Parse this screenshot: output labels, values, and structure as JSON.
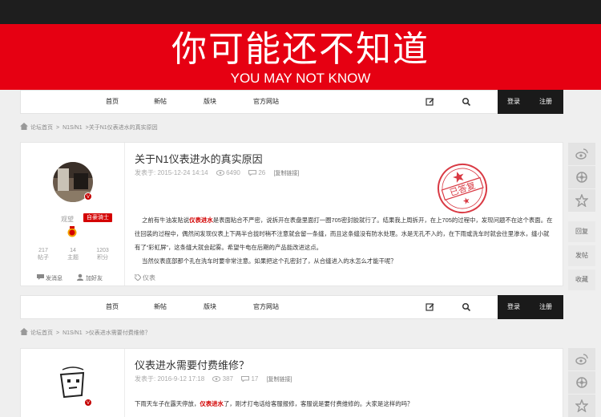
{
  "banner": {
    "title_cn": "你可能还不知道",
    "title_en": "YOU MAY NOT KNOW"
  },
  "nav": {
    "items": [
      "首页",
      "新帖",
      "版块",
      "官方网站"
    ],
    "login": "登录",
    "register": "注册"
  },
  "post1": {
    "breadcrumb": [
      "论坛首页",
      ">",
      "N1S/N1",
      ">关于N1仪表进水的真实原因"
    ],
    "author": {
      "name": "观望",
      "level": "自豪骑士",
      "stats": [
        {
          "value": "217",
          "label": "帖子"
        },
        {
          "value": "14",
          "label": "主题"
        },
        {
          "value": "1203",
          "label": "积分"
        }
      ],
      "send_message": "发消息",
      "add_friend": "加好友"
    },
    "title": "关于N1仪表进水的真实原因",
    "date": "发表于: 2015-12-24 14:14",
    "views": "6490",
    "replies": "26",
    "copy_link": "[复制链接]",
    "stamp": "已答复",
    "body": {
      "p1_before": "之前有牛油发贴说",
      "p1_highlight": "仪表进水",
      "p1_after": "是表面粘合不严密，说拆开在表盘里面打一圈705密封胶就行了。结果我上周拆开，在上705的过程中，发现问题不在这个表面。在往回装的过程中，偶然间发现仪表上下两半合拢时稍不注意就会留一条缝，而且这条缝没有防水处理。水是无孔不入的，在下雨或洗车时就会往里渗水，缝小就有了“彩虹屏”，这条缝大就会起雾。希望牛电在后期的产品能改进这点。",
      "p2": "当然仪表底部那个孔在洗车时要非常注意。如果把这个孔密封了，从合缝进入的水怎么才能干呢？"
    },
    "tag": "仪表"
  },
  "post2": {
    "breadcrumb": [
      "论坛首页",
      ">",
      "N1S/N1",
      ">仪表进水需要付费维修？"
    ],
    "title": "仪表进水需要付费维修？",
    "date": "发表于: 2016-9-12 17:18",
    "views": "387",
    "replies": "17",
    "copy_link": "[复制链接]",
    "body": {
      "before": "下雨天车子在露天停放，",
      "highlight": "仪表进水",
      "after": "了，刚才打电话给客服报修，客服说是要付费维修的。大家是这样的吗？"
    }
  },
  "rail": {
    "icons": [
      "weibo-icon",
      "wechat-moments-icon",
      "star-icon"
    ],
    "reply": "回复",
    "new_post": "发帖",
    "collect": "收藏"
  },
  "colors": {
    "banner_red": "#e60012",
    "highlight_red": "#d20000",
    "dark": "#1a1a1a"
  }
}
